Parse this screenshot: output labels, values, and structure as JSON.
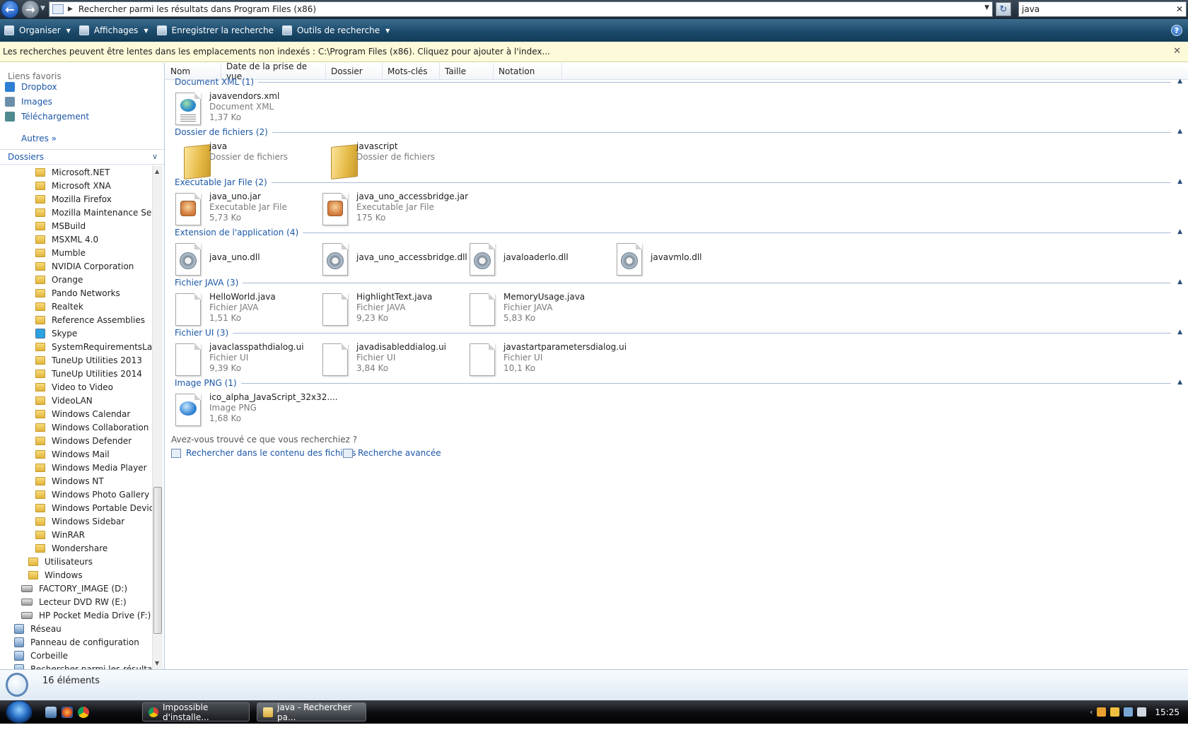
{
  "addressbar": {
    "path_label": "Rechercher parmi les résultats dans Program Files (x86)",
    "search_value": "java"
  },
  "commandbar": {
    "organize": "Organiser",
    "views": "Affichages",
    "save_search": "Enregistrer la recherche",
    "search_tools": "Outils de recherche"
  },
  "infobar": {
    "message": "Les recherches peuvent être lentes dans les emplacements non indexés : C:\\Program Files (x86). Cliquez pour ajouter à l'index..."
  },
  "favorites": {
    "header": "Liens favoris",
    "items": [
      {
        "label": "Dropbox",
        "icon": "dropbox-icon"
      },
      {
        "label": "Images",
        "icon": "images-icon"
      },
      {
        "label": "Téléchargement",
        "icon": "downloads-icon"
      }
    ],
    "more": "Autres »"
  },
  "folders": {
    "header": "Dossiers",
    "items": [
      {
        "label": "Microsoft.NET",
        "level": 3,
        "icon": "folder"
      },
      {
        "label": "Microsoft XNA",
        "level": 3,
        "icon": "folder"
      },
      {
        "label": "Mozilla Firefox",
        "level": 3,
        "icon": "folder"
      },
      {
        "label": "Mozilla Maintenance Servic",
        "level": 3,
        "icon": "folder"
      },
      {
        "label": "MSBuild",
        "level": 3,
        "icon": "folder"
      },
      {
        "label": "MSXML 4.0",
        "level": 3,
        "icon": "folder"
      },
      {
        "label": "Mumble",
        "level": 3,
        "icon": "folder"
      },
      {
        "label": "NVIDIA Corporation",
        "level": 3,
        "icon": "folder"
      },
      {
        "label": "Orange",
        "level": 3,
        "icon": "folder"
      },
      {
        "label": "Pando Networks",
        "level": 3,
        "icon": "folder"
      },
      {
        "label": "Realtek",
        "level": 3,
        "icon": "folder"
      },
      {
        "label": "Reference Assemblies",
        "level": 3,
        "icon": "folder"
      },
      {
        "label": "Skype",
        "level": 3,
        "icon": "skype"
      },
      {
        "label": "SystemRequirementsLab",
        "level": 3,
        "icon": "folder"
      },
      {
        "label": "TuneUp Utilities 2013",
        "level": 3,
        "icon": "folder"
      },
      {
        "label": "TuneUp Utilities 2014",
        "level": 3,
        "icon": "folder"
      },
      {
        "label": "Video to Video",
        "level": 3,
        "icon": "folder"
      },
      {
        "label": "VideoLAN",
        "level": 3,
        "icon": "folder"
      },
      {
        "label": "Windows Calendar",
        "level": 3,
        "icon": "folder"
      },
      {
        "label": "Windows Collaboration",
        "level": 3,
        "icon": "folder"
      },
      {
        "label": "Windows Defender",
        "level": 3,
        "icon": "folder"
      },
      {
        "label": "Windows Mail",
        "level": 3,
        "icon": "folder"
      },
      {
        "label": "Windows Media Player",
        "level": 3,
        "icon": "folder"
      },
      {
        "label": "Windows NT",
        "level": 3,
        "icon": "folder"
      },
      {
        "label": "Windows Photo Gallery",
        "level": 3,
        "icon": "folder"
      },
      {
        "label": "Windows Portable Devices",
        "level": 3,
        "icon": "folder"
      },
      {
        "label": "Windows Sidebar",
        "level": 3,
        "icon": "folder"
      },
      {
        "label": "WinRAR",
        "level": 3,
        "icon": "folder"
      },
      {
        "label": "Wondershare",
        "level": 3,
        "icon": "folder"
      },
      {
        "label": "Utilisateurs",
        "level": 2,
        "icon": "folder"
      },
      {
        "label": "Windows",
        "level": 2,
        "icon": "folder"
      },
      {
        "label": "FACTORY_IMAGE (D:)",
        "level": 1,
        "icon": "drive"
      },
      {
        "label": "Lecteur DVD RW (E:)",
        "level": 1,
        "icon": "drive"
      },
      {
        "label": "HP Pocket Media Drive (F:)",
        "level": 1,
        "icon": "drive"
      },
      {
        "label": "Réseau",
        "level": 0,
        "icon": "system"
      },
      {
        "label": "Panneau de configuration",
        "level": 0,
        "icon": "system"
      },
      {
        "label": "Corbeille",
        "level": 0,
        "icon": "system"
      },
      {
        "label": "Rechercher parmi les résultats de",
        "level": 0,
        "icon": "system"
      }
    ]
  },
  "columns": [
    "Nom",
    "Date de la prise de vue",
    "Dossier",
    "Mots-clés",
    "Taille",
    "Notation"
  ],
  "groups": [
    {
      "header": "Document XML (1)",
      "files": [
        {
          "name": "javavendors.xml",
          "type": "Document XML",
          "size": "1,37 Ko",
          "icon": "xml"
        }
      ]
    },
    {
      "header": "Dossier de fichiers (2)",
      "files": [
        {
          "name": "java",
          "type": "Dossier de fichiers",
          "size": "",
          "icon": "folder"
        },
        {
          "name": "javascript",
          "type": "Dossier de fichiers",
          "size": "",
          "icon": "folder"
        }
      ]
    },
    {
      "header": "Executable Jar File (2)",
      "files": [
        {
          "name": "java_uno.jar",
          "type": "Executable Jar File",
          "size": "5,73 Ko",
          "icon": "jar"
        },
        {
          "name": "java_uno_accessbridge.jar",
          "type": "Executable Jar File",
          "size": "175 Ko",
          "icon": "jar"
        }
      ]
    },
    {
      "header": "Extension de l'application (4)",
      "files": [
        {
          "name": "java_uno.dll",
          "type": "",
          "size": "",
          "icon": "dll"
        },
        {
          "name": "java_uno_accessbridge.dll",
          "type": "",
          "size": "",
          "icon": "dll"
        },
        {
          "name": "javaloaderlo.dll",
          "type": "",
          "size": "",
          "icon": "dll"
        },
        {
          "name": "javavmlo.dll",
          "type": "",
          "size": "",
          "icon": "dll"
        }
      ]
    },
    {
      "header": "Fichier JAVA (3)",
      "files": [
        {
          "name": "HelloWorld.java",
          "type": "Fichier JAVA",
          "size": "1,51 Ko",
          "icon": "blank"
        },
        {
          "name": "HighlightText.java",
          "type": "Fichier JAVA",
          "size": "9,23 Ko",
          "icon": "blank"
        },
        {
          "name": "MemoryUsage.java",
          "type": "Fichier JAVA",
          "size": "5,83 Ko",
          "icon": "blank"
        }
      ]
    },
    {
      "header": "Fichier UI (3)",
      "files": [
        {
          "name": "javaclasspathdialog.ui",
          "type": "Fichier UI",
          "size": "9,39 Ko",
          "icon": "blank"
        },
        {
          "name": "javadisableddialog.ui",
          "type": "Fichier UI",
          "size": "3,84 Ko",
          "icon": "blank"
        },
        {
          "name": "javastartparametersdialog.ui",
          "type": "Fichier UI",
          "size": "10,1 Ko",
          "icon": "blank"
        }
      ]
    },
    {
      "header": "Image PNG (1)",
      "files": [
        {
          "name": "ico_alpha_JavaScript_32x32....",
          "type": "Image PNG",
          "size": "1,68 Ko",
          "icon": "png"
        }
      ]
    }
  ],
  "footer": {
    "question": "Avez-vous trouvé ce que vous recherchiez ?",
    "search_content": "Rechercher dans le contenu des fichiers",
    "advanced": "Recherche avancée"
  },
  "details": {
    "count": "16 éléments"
  },
  "taskbar": {
    "tasks": [
      {
        "label": "Impossible d'installe...",
        "icon": "chrome-icon"
      },
      {
        "label": "java - Rechercher pa...",
        "icon": "explorer-icon"
      }
    ],
    "clock": "15:25"
  }
}
